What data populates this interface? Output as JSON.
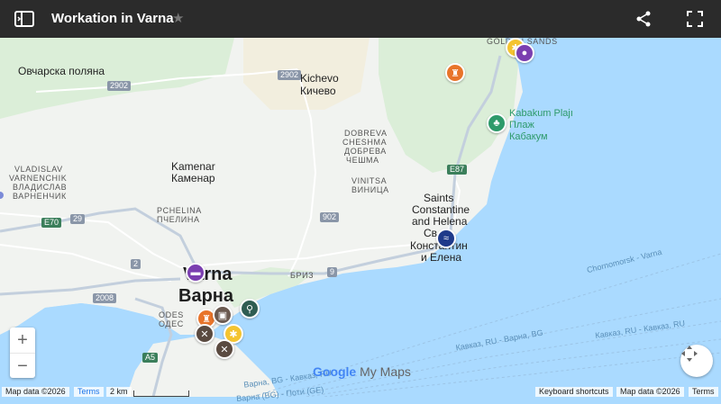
{
  "topbar": {
    "title": "Workation in Varna",
    "icons": {
      "sidebar": "sidebar-toggle-icon",
      "star": "star-icon",
      "share": "share-icon",
      "fullscreen": "fullscreen-icon"
    }
  },
  "labels": {
    "ovcharska": "Овчарска поляна",
    "kichevo_en": "Kichevo",
    "kichevo_bg": "Кичево",
    "dobreva_en1": "DOBREVA",
    "dobreva_en2": "CHESHMA",
    "dobreva_bg1": "ДОБРЕВА",
    "dobreva_bg2": "ЧЕШМА",
    "vladislav_en1": "VLADISLAV",
    "vladislav_en2": "VARNENCHIK",
    "vladislav_bg1": "ВЛАДИСЛАВ",
    "vladislav_bg2": "ВАРНЕНЧИК",
    "kamenar_en": "Kamenar",
    "kamenar_bg": "Каменар",
    "vinitsa_en": "VINITSA",
    "vinitsa_bg": "ВИНИЦА",
    "pchelina_en": "PCHELINA",
    "pchelina_bg": "ПЧЕЛИНА",
    "saints1": "Saints",
    "saints2": "Constantine",
    "saints3": "and Helena",
    "saints4": "Св.",
    "konst1": "Константин",
    "konst2": "и Елена",
    "kabakum1": "Kabakum Plajı",
    "kabakum2": "Плаж",
    "kabakum3": "Кабакум",
    "golden": "GOLDEN SANDS",
    "varna_en": "Varna",
    "varna_bg": "Варна",
    "odesos1": "ODES",
    "odesos2": "ОДЕС",
    "briz": "БРИЗ",
    "cable1": "Chornomorsk - Varna",
    "cable2": "Кавказ, RU - Варна, BG",
    "cable3": "Кавказ, RU - Кавказ, RU",
    "cable4": "Варна, BG - Кавказ, RU",
    "cable5": "Варна (BG) - Поти (GE)"
  },
  "shields": [
    "2902",
    "2902",
    "E87",
    "E70",
    "29",
    "902",
    "2",
    "9",
    "2008",
    "A5"
  ],
  "controls": {
    "zoom_in": "+",
    "zoom_out": "−"
  },
  "footer": {
    "map_data_left": "Map data ©2026",
    "terms_left": "Terms",
    "scale": "2 km",
    "keyboard": "Keyboard shortcuts",
    "map_data_right": "Map data ©2026",
    "terms_right": "Terms"
  },
  "branding": {
    "google": "Google",
    "mymaps": "My Maps"
  },
  "colors": {
    "sea": "#aadaff",
    "land": "#f1f3f0",
    "green": "#d6ecd2",
    "road": "#ffffff",
    "highway": "#c3cfdd",
    "topbar": "#2b2b2b"
  }
}
